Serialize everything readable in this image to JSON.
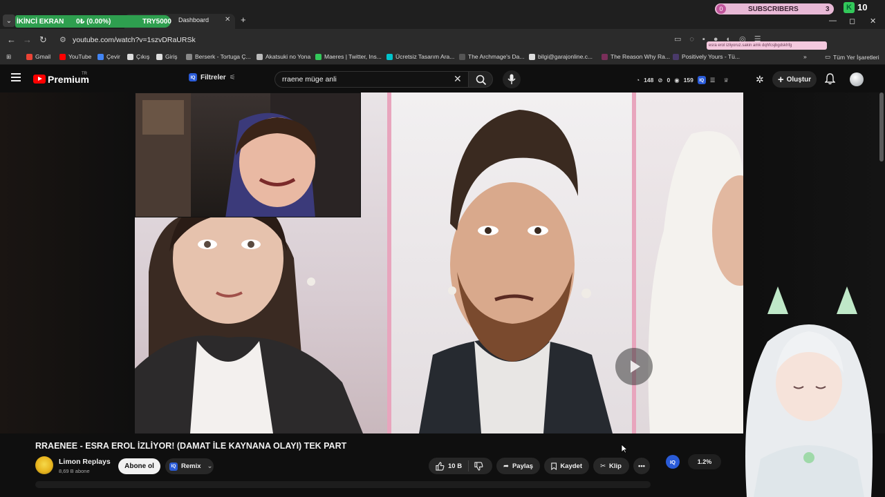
{
  "browser": {
    "tab_title": "Dashboard",
    "url": "youtube.com/watch?v=1szvDRaURSk",
    "window_controls": {
      "minimize": "—",
      "maximize": "◻",
      "close": "✕"
    }
  },
  "stream_overlay": {
    "left_label": "İKİNCİ EKRAN",
    "progress_text": "0₺ (0.00%)",
    "goal_label": "TRY5000",
    "subscribers_count_left": "0",
    "subscribers_label": "SUBSCRIBERS",
    "subscribers_count_right": "3",
    "k_count": "10",
    "pink_note": "esra erol izliyoruz.sakin amk dqhfcsjbgdskhfg"
  },
  "bookmarks": [
    {
      "label": "Gmail",
      "color": "#ea4335"
    },
    {
      "label": "YouTube",
      "color": "#ff0000"
    },
    {
      "label": "Çevir",
      "color": "#4285f4"
    },
    {
      "label": "Çıkış",
      "color": "#dddddd"
    },
    {
      "label": "Giriş",
      "color": "#dddddd"
    },
    {
      "label": "Berserk - Tortuga Ç...",
      "color": "#888888"
    },
    {
      "label": "Akatsuki no Yona",
      "color": "#bbbbbb"
    },
    {
      "label": "Maeres | Twitter, Ins...",
      "color": "#33c85a"
    },
    {
      "label": "Ücretsiz Tasarım Ara...",
      "color": "#00c4cc"
    },
    {
      "label": "The Archmage's Da...",
      "color": "#555555"
    },
    {
      "label": "bilgi@garajonline.c...",
      "color": "#dddddd"
    },
    {
      "label": "The Reason Why Ra...",
      "color": "#7a2f5a"
    },
    {
      "label": "Positively Yours - Tü...",
      "color": "#4a3a6a"
    }
  ],
  "bookmarks_more": "»",
  "bookmarks_all": "Tüm Yer İşaretleri",
  "youtube": {
    "logo_text": "Premium",
    "region": "TR",
    "filters_label": "Filtreler",
    "search_query": "rraene müge anli",
    "stats": {
      "a": "148",
      "b": "0",
      "c": "159"
    },
    "create_label": "Oluştur",
    "video_title": "RRAENEE - ESRA EROL İZLİYOR! (DAMAT İLE KAYNANA OLAYI) TEK PART",
    "channel_name": "Limon Replays",
    "channel_subs": "8,69 B abone",
    "subscribe_label": "Abone ol",
    "remix_label": "Remix",
    "like_count": "10 B",
    "share_label": "Paylaş",
    "save_label": "Kaydet",
    "clip_label": "Klip",
    "iq_label": "IQ",
    "percent": "1.2%"
  }
}
